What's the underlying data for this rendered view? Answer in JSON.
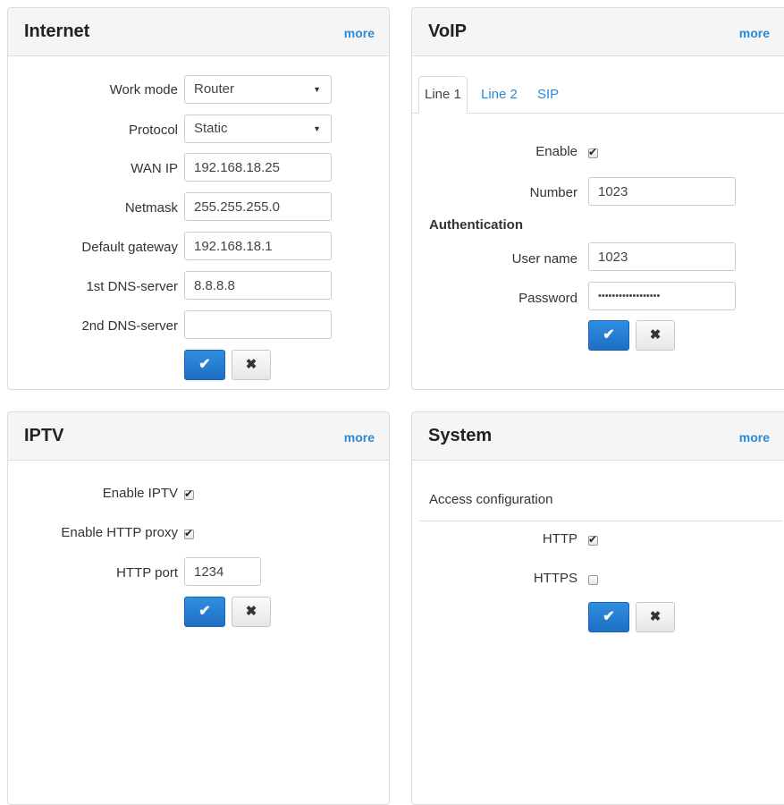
{
  "internet": {
    "title": "Internet",
    "more": "more",
    "fields": {
      "work_mode": {
        "label": "Work mode",
        "value": "Router"
      },
      "protocol": {
        "label": "Protocol",
        "value": "Static"
      },
      "wan_ip": {
        "label": "WAN IP",
        "value": "192.168.18.25"
      },
      "netmask": {
        "label": "Netmask",
        "value": "255.255.255.0"
      },
      "gateway": {
        "label": "Default gateway",
        "value": "192.168.18.1"
      },
      "dns1": {
        "label": "1st DNS-server",
        "value": "8.8.8.8"
      },
      "dns2": {
        "label": "2nd DNS-server",
        "value": ""
      }
    },
    "ok_icon": "✔",
    "cancel_icon": "✖"
  },
  "voip": {
    "title": "VoIP",
    "more": "more",
    "tabs": [
      {
        "label": "Line 1",
        "active": true
      },
      {
        "label": "Line 2",
        "active": false
      },
      {
        "label": "SIP",
        "active": false
      }
    ],
    "enable": {
      "label": "Enable",
      "checked": true
    },
    "number": {
      "label": "Number",
      "value": "1023"
    },
    "auth_heading": "Authentication",
    "username": {
      "label": "User name",
      "value": "1023"
    },
    "password": {
      "label": "Password",
      "value": "••••••••••••••••••"
    },
    "ok_icon": "✔",
    "cancel_icon": "✖"
  },
  "iptv": {
    "title": "IPTV",
    "more": "more",
    "enable_iptv": {
      "label": "Enable IPTV",
      "checked": true
    },
    "enable_proxy": {
      "label": "Enable HTTP proxy",
      "checked": true
    },
    "http_port": {
      "label": "HTTP port",
      "value": "1234"
    },
    "ok_icon": "✔",
    "cancel_icon": "✖"
  },
  "system": {
    "title": "System",
    "more": "more",
    "access_heading": "Access configuration",
    "http": {
      "label": "HTTP",
      "checked": true
    },
    "https": {
      "label": "HTTPS",
      "checked": false
    },
    "ok_icon": "✔",
    "cancel_icon": "✖"
  },
  "colors": {
    "link": "#2a8ad8",
    "primary_button": "#1f6fc4",
    "panel_header": "#f5f5f5"
  }
}
